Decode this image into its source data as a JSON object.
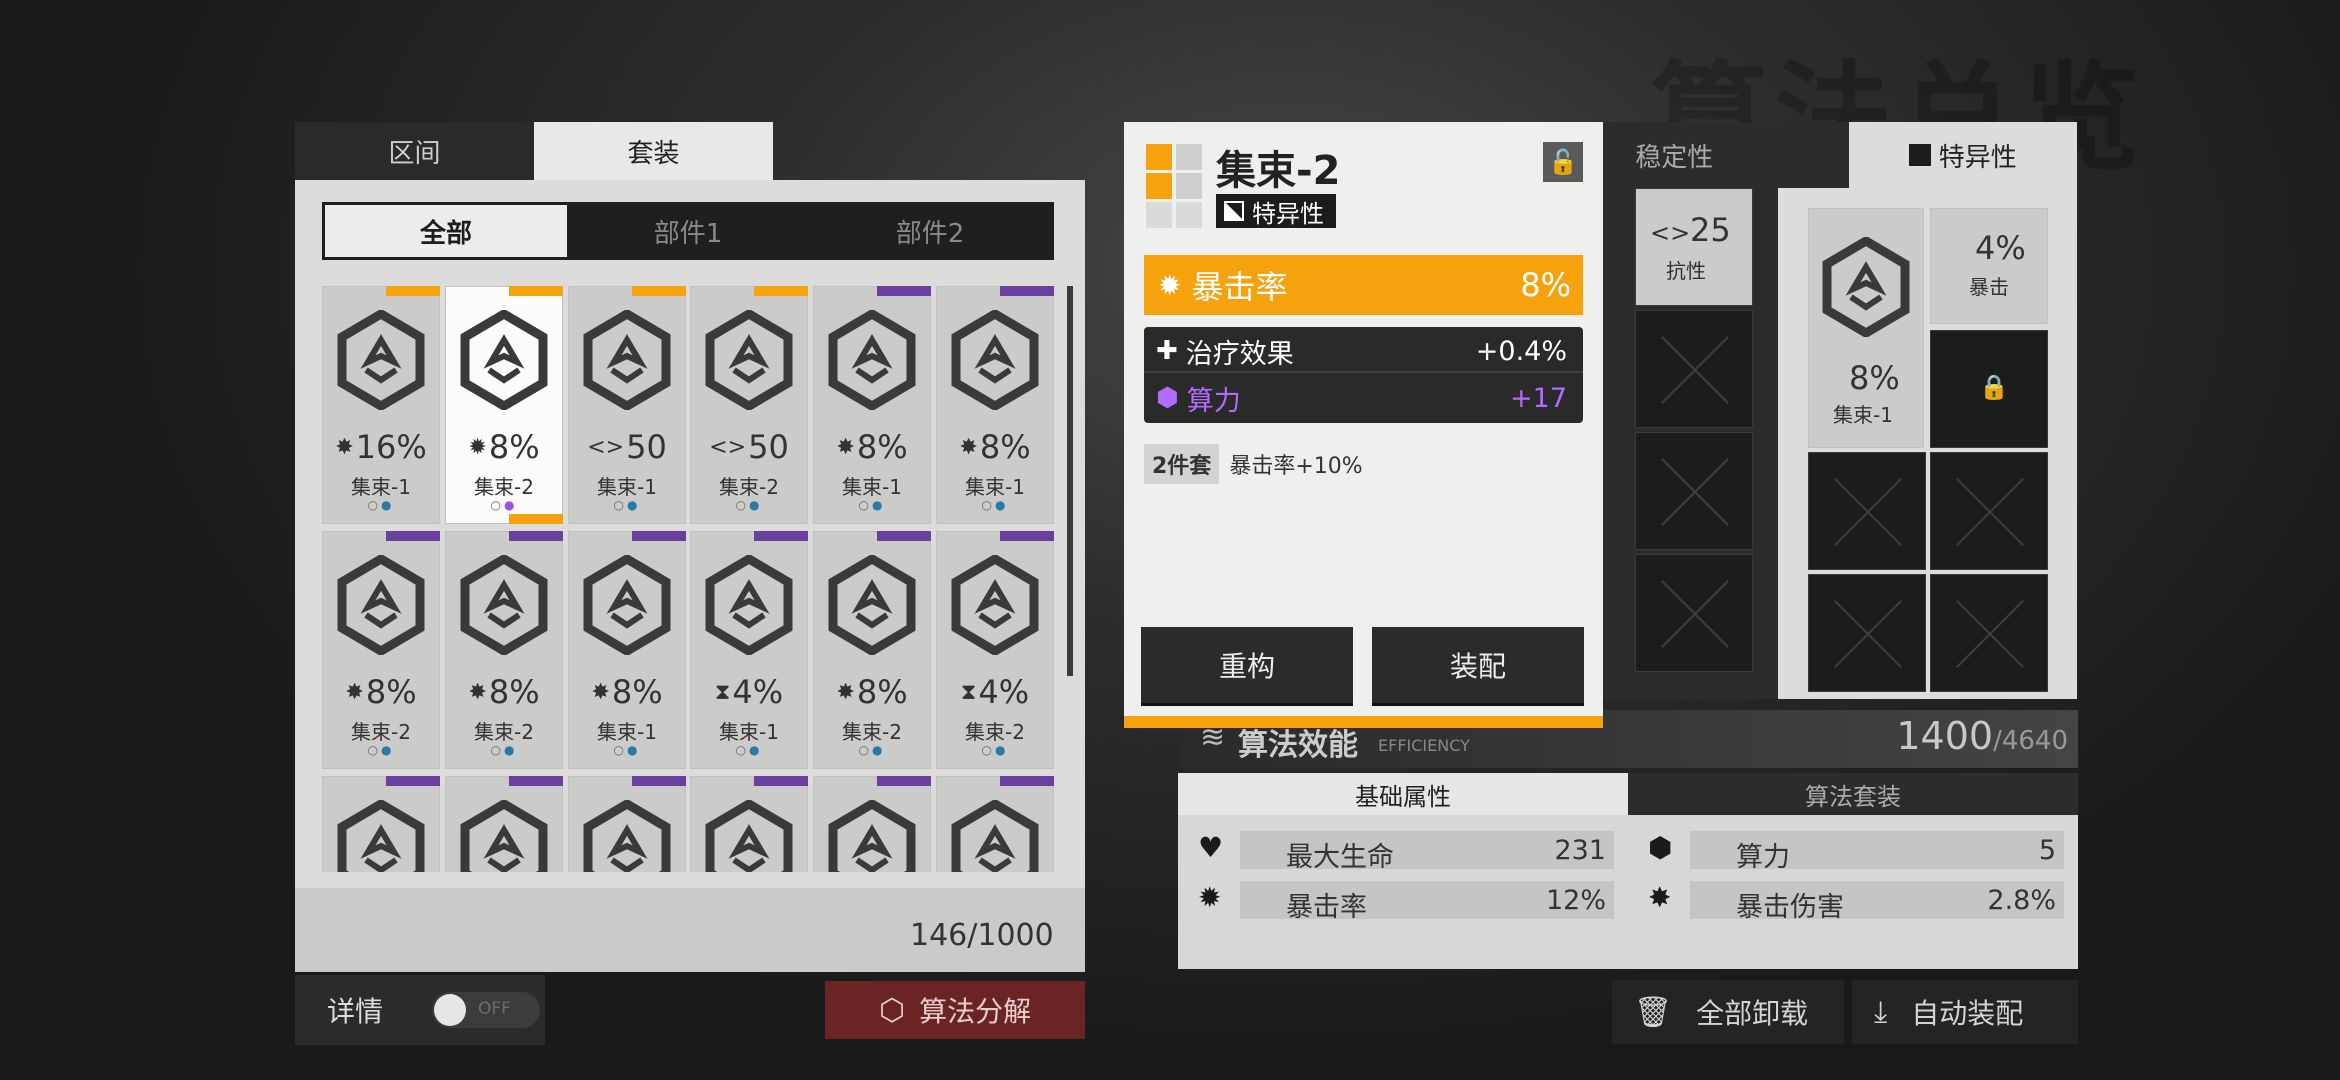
{
  "bg_title": "算法总览",
  "left": {
    "tabs": [
      "区间",
      "套装"
    ],
    "active_tab": 1,
    "filters": [
      "全部",
      "部件1",
      "部件2"
    ],
    "active_filter": 0,
    "cards": [
      {
        "icon": "gear-burst-icon",
        "stat": "16%",
        "name": "集束-1",
        "rarity": "orange"
      },
      {
        "icon": "crit-gear-icon",
        "stat": "8%",
        "name": "集束-2",
        "rarity": "orange",
        "selected": true
      },
      {
        "icon": "resist-icon",
        "stat": "50",
        "name": "集束-1",
        "rarity": "orange"
      },
      {
        "icon": "resist-icon",
        "stat": "50",
        "name": "集束-2",
        "rarity": "orange"
      },
      {
        "icon": "gear-burst-icon",
        "stat": "8%",
        "name": "集束-1",
        "rarity": "purple"
      },
      {
        "icon": "gear-burst-icon",
        "stat": "8%",
        "name": "集束-1",
        "rarity": "purple"
      },
      {
        "icon": "gear-burst-icon",
        "stat": "8%",
        "name": "集束-2",
        "rarity": "purple"
      },
      {
        "icon": "gear-burst-icon",
        "stat": "8%",
        "name": "集束-2",
        "rarity": "purple"
      },
      {
        "icon": "gear-burst-icon",
        "stat": "8%",
        "name": "集束-1",
        "rarity": "purple"
      },
      {
        "icon": "hourglass-icon",
        "stat": "4%",
        "name": "集束-1",
        "rarity": "purple"
      },
      {
        "icon": "gear-burst-icon",
        "stat": "8%",
        "name": "集束-2",
        "rarity": "purple"
      },
      {
        "icon": "hourglass-icon",
        "stat": "4%",
        "name": "集束-2",
        "rarity": "purple"
      },
      {
        "icon": "",
        "stat": "",
        "name": "",
        "rarity": "purple"
      },
      {
        "icon": "",
        "stat": "",
        "name": "",
        "rarity": "purple"
      },
      {
        "icon": "",
        "stat": "",
        "name": "",
        "rarity": "purple"
      },
      {
        "icon": "",
        "stat": "",
        "name": "",
        "rarity": "purple"
      },
      {
        "icon": "",
        "stat": "",
        "name": "",
        "rarity": "purple"
      },
      {
        "icon": "",
        "stat": "",
        "name": "",
        "rarity": "purple"
      }
    ],
    "count": "146/1000",
    "detail_label": "详情",
    "toggle_text": "OFF",
    "decompose_label": "算法分解"
  },
  "popup": {
    "title": "集束-2",
    "tag": "特异性",
    "main_stat": {
      "icon": "crit-gear-icon",
      "label": "暴击率",
      "value": "8%"
    },
    "sub_stats": [
      {
        "icon": "heal-plus-icon",
        "label": "治疗效果",
        "value": "+0.4%",
        "color": "#ffffff"
      },
      {
        "icon": "compute-hex-icon",
        "label": "算力",
        "value": "+17",
        "color": "#b36bff"
      }
    ],
    "set_badge": "2件套",
    "set_effect": "暴击率+10%",
    "btn_rebuild": "重构",
    "btn_equip": "装配"
  },
  "right": {
    "tabs": [
      "稳定性",
      "特异性"
    ],
    "partial_cards": [
      {
        "stat": "25",
        "name": "抗性"
      }
    ],
    "equipped_main": {
      "stat": "8%",
      "name": "集束-1"
    },
    "equipped_small": {
      "stat": "4%",
      "name": "暴击"
    },
    "efficiency_label": "算法效能",
    "efficiency_sub": "EFFICIENCY",
    "efficiency_value": "1400",
    "efficiency_max": "/4640",
    "stat_tabs": [
      "基础属性",
      "算法套装"
    ],
    "stats": [
      {
        "icon": "heart-icon",
        "label": "最大生命",
        "value": "231"
      },
      {
        "icon": "compute-hex-icon",
        "label": "算力",
        "value": "5"
      },
      {
        "icon": "crit-gear-icon",
        "label": "暴击率",
        "value": "12%"
      },
      {
        "icon": "gear-burst-icon",
        "label": "暴击伤害",
        "value": "2.8%"
      }
    ],
    "btn_unload": "全部卸载",
    "btn_auto": "自动装配"
  },
  "colors": {
    "orange": "#f6a20f",
    "purple": "#6b3fa0",
    "accent_red": "#6b2424"
  }
}
